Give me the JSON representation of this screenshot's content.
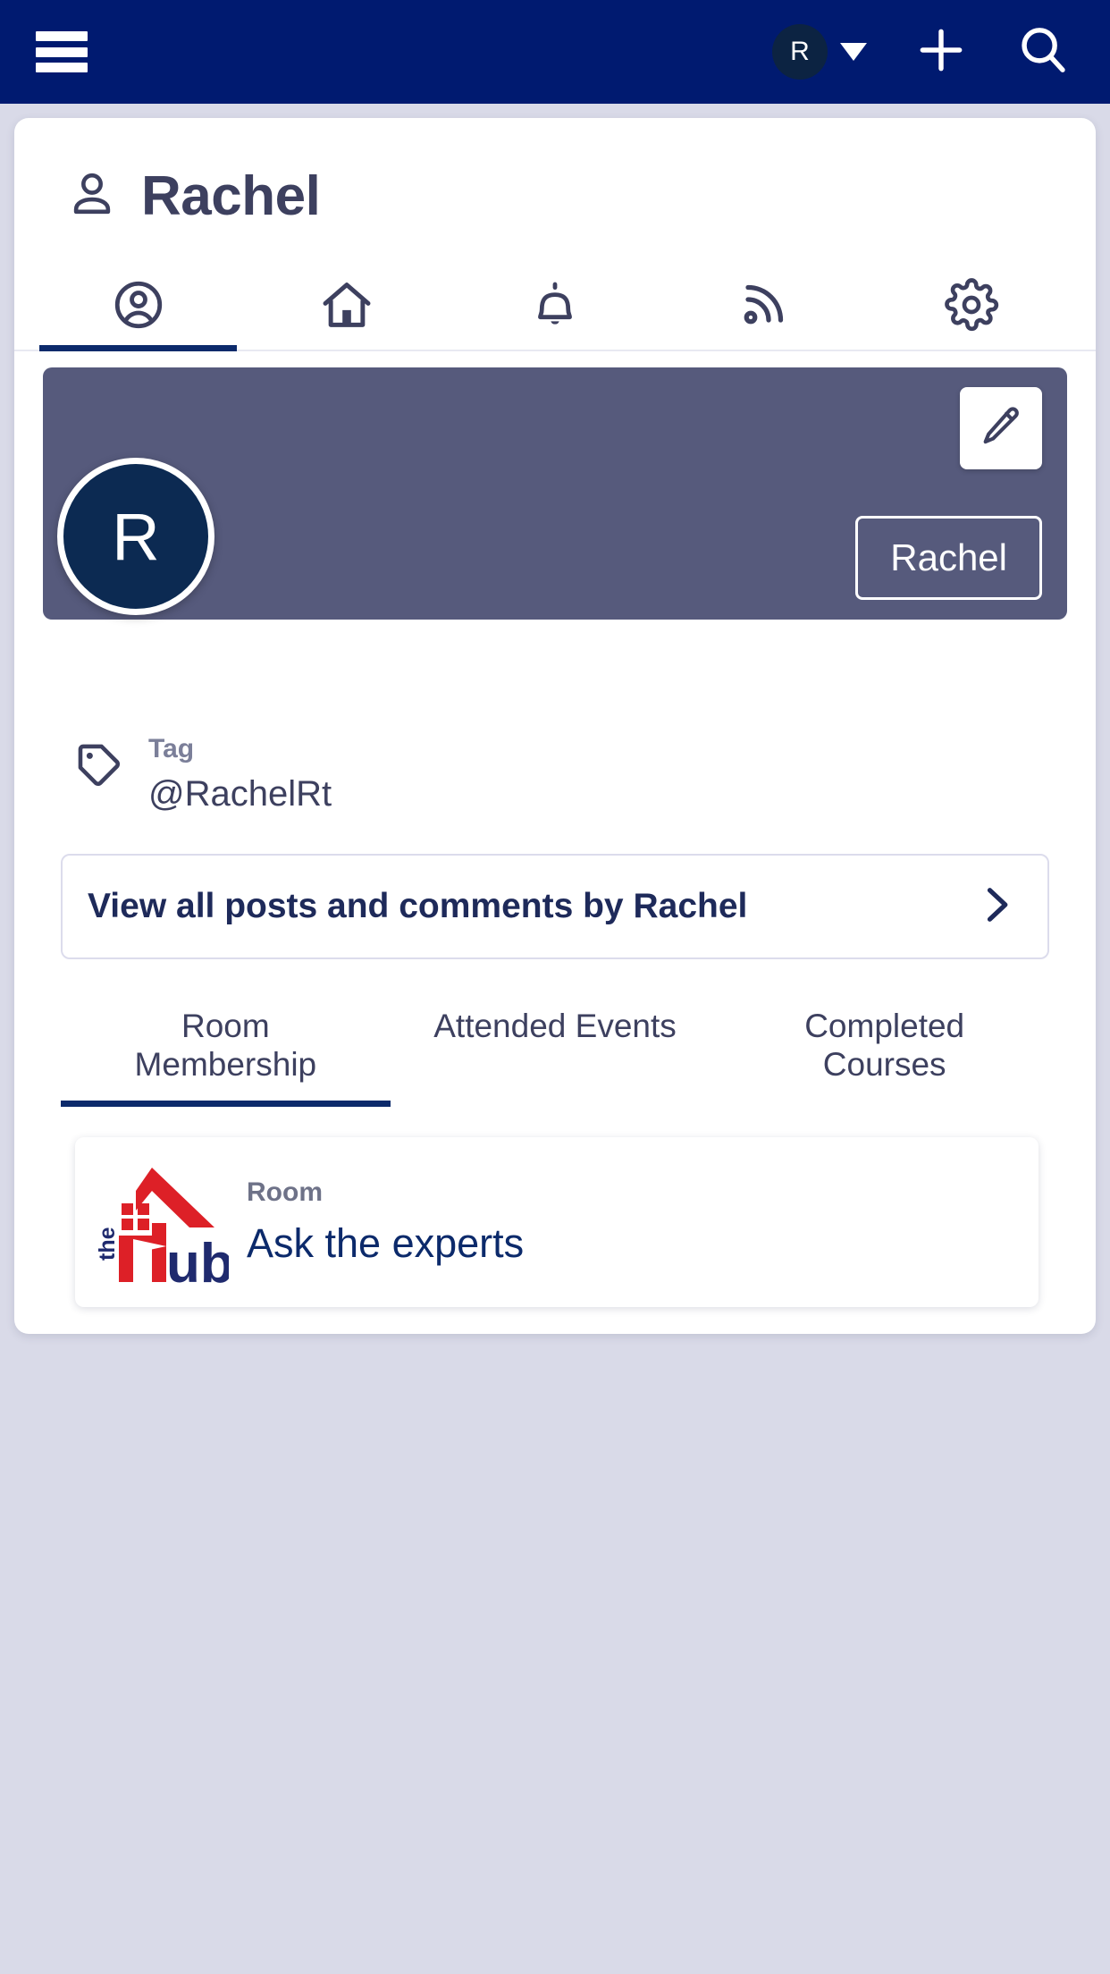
{
  "colors": {
    "topbar_navy": "#001a70",
    "page_background": "#d9dae8",
    "card_white": "#ffffff",
    "banner_slate": "#565a7c",
    "accent_navy": "#0c2a6b",
    "avatar_navy": "#0c2a52",
    "title_slate": "#3d405f",
    "muted_gray": "#7b7f99",
    "logo_red": "#dd2027",
    "logo_navy": "#1f2a6e"
  },
  "topbar": {
    "menu_icon": "hamburger-menu-icon",
    "user_initial": "R",
    "dropdown_icon": "chevron-down-icon",
    "add_icon": "plus-icon",
    "search_icon": "search-icon"
  },
  "header": {
    "icon": "person-icon",
    "title": "Rachel"
  },
  "icon_tabs": [
    {
      "name": "profile",
      "icon": "user-circle-icon",
      "active": true
    },
    {
      "name": "home",
      "icon": "home-icon",
      "active": false
    },
    {
      "name": "notifications",
      "icon": "bell-icon",
      "active": false
    },
    {
      "name": "feed",
      "icon": "rss-feed-icon",
      "active": false
    },
    {
      "name": "settings",
      "icon": "gear-icon",
      "active": false
    }
  ],
  "banner": {
    "edit_icon": "pencil-edit-icon",
    "name_badge": "Rachel"
  },
  "avatar": {
    "initial": "R"
  },
  "tag": {
    "icon": "tag-icon",
    "label": "Tag",
    "value": "@RachelRt"
  },
  "view_posts": {
    "label": "View all posts and comments by Rachel",
    "chevron_icon": "chevron-right-icon"
  },
  "sub_tabs": [
    {
      "label": "Room Membership",
      "line1": "Room",
      "line2": "Membership",
      "active": true
    },
    {
      "label": "Attended Events",
      "line1": "Attended Events",
      "line2": "",
      "active": false
    },
    {
      "label": "Completed Courses",
      "line1": "Completed",
      "line2": "Courses",
      "active": false
    }
  ],
  "room_card": {
    "logo": "the-hub-logo",
    "logo_text_the": "the",
    "logo_text_hub": "Hub",
    "meta_label": "Room",
    "meta_title": "Ask the experts"
  }
}
